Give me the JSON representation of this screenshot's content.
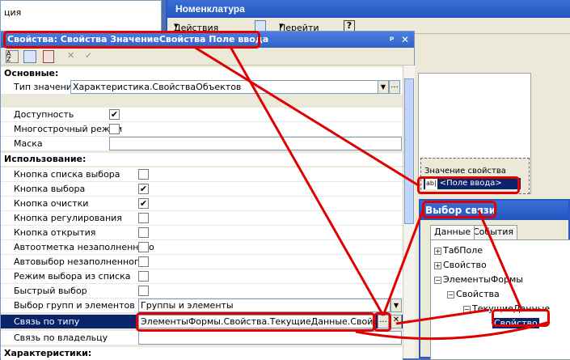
{
  "bg_left": {
    "item_text": "ция"
  },
  "nom_window": {
    "title": "Номенклатура",
    "actions_label": "Действия",
    "goto_label": "Перейти",
    "help_label": "?",
    "grid_header": "Значение свойства",
    "grid_cell": "<Поле ввода>",
    "grid_cell_icon": "ab|"
  },
  "props": {
    "title": "Свойства: Свойства ЗначениеСвойства Поле ввода",
    "pin": "ᵖ",
    "close": "✕",
    "sections": {
      "basic": "Основные:",
      "usage": "Использование:",
      "characteristics": "Характеристики:"
    },
    "rows": {
      "value_type": {
        "label": "Тип значения",
        "value": "Характеристика.СвойстваОбъектов"
      },
      "availability": {
        "label": "Доступность",
        "checked": "✔"
      },
      "multiline": {
        "label": "Многострочный режим",
        "checked": ""
      },
      "mask": {
        "label": "Маска",
        "value": ""
      },
      "list_btn": {
        "label": "Кнопка списка выбора",
        "checked": ""
      },
      "select_btn": {
        "label": "Кнопка выбора",
        "checked": "✔"
      },
      "clear_btn": {
        "label": "Кнопка очистки",
        "checked": "✔"
      },
      "adjust_btn": {
        "label": "Кнопка регулирования",
        "checked": ""
      },
      "open_btn": {
        "label": "Кнопка открытия",
        "checked": ""
      },
      "automark": {
        "label": "Автоотметка незаполненного",
        "checked": ""
      },
      "autoselect": {
        "label": "Автовыбор незаполненного",
        "checked": ""
      },
      "list_mode": {
        "label": "Режим выбора из списка",
        "checked": ""
      },
      "quick": {
        "label": "Быстрый выбор",
        "checked": ""
      },
      "groups": {
        "label": "Выбор групп и элементов",
        "value": "Группы и элементы"
      },
      "link_type": {
        "label": "Связь по типу",
        "value": "ЭлементыФормы.Свойства.ТекущиеДанные.Свойство"
      },
      "link_owner": {
        "label": "Связь по владельцу",
        "value": ""
      }
    }
  },
  "vyb": {
    "title": "Выбор связи",
    "tab_data": "Данные",
    "tab_events": "События",
    "tree": [
      "ТабПоле",
      "Свойство",
      "ЭлементыФормы",
      "Свойства",
      "ТекущиеДанные",
      "Свойство"
    ]
  },
  "colors": {
    "annotation": "#e00000",
    "selection": "#0a246a",
    "title_blue": "#2454c0"
  }
}
